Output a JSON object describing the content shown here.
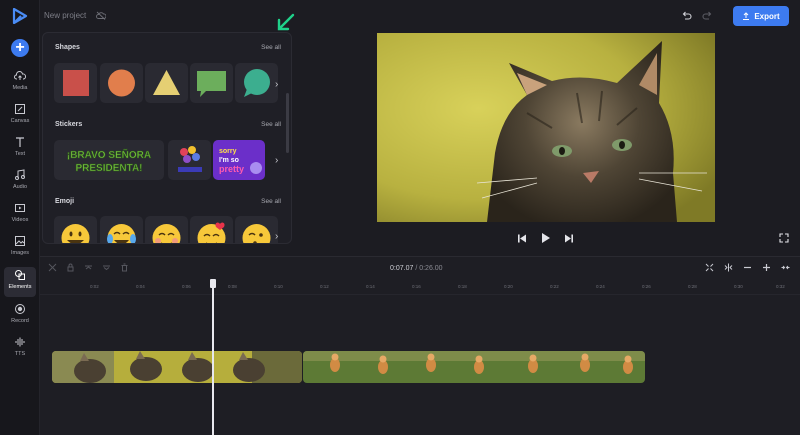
{
  "app": {
    "project_name": "New project",
    "export_label": "Export",
    "accent": "#3d7bf0"
  },
  "sidebar": {
    "add_label": "+",
    "items": [
      {
        "label": "Media",
        "icon": "cloud-upload-icon"
      },
      {
        "label": "Canvas",
        "icon": "canvas-icon"
      },
      {
        "label": "Text",
        "icon": "text-icon"
      },
      {
        "label": "Audio",
        "icon": "music-icon"
      },
      {
        "label": "Videos",
        "icon": "video-icon"
      },
      {
        "label": "Images",
        "icon": "image-icon"
      },
      {
        "label": "Elements",
        "icon": "elements-icon",
        "active": true
      },
      {
        "label": "Record",
        "icon": "record-icon"
      },
      {
        "label": "TTS",
        "icon": "tts-icon"
      }
    ]
  },
  "panel": {
    "shapes": {
      "title": "Shapes",
      "see_all": "See all",
      "items": [
        {
          "shape": "square",
          "color": "#c9504a"
        },
        {
          "shape": "circle",
          "color": "#e17e4c"
        },
        {
          "shape": "triangle",
          "color": "#e5cf73"
        },
        {
          "shape": "speech-bubble-rect",
          "color": "#6cae5c"
        },
        {
          "shape": "speech-bubble-round",
          "color": "#3cae8f"
        }
      ]
    },
    "stickers": {
      "title": "Stickers",
      "see_all": "See all",
      "items": [
        {
          "text": "¡BRAVO SEÑORA PRESIDENTA!"
        },
        {
          "text": "balloons"
        },
        {
          "text": "sorry I'm so pretty"
        }
      ]
    },
    "emoji": {
      "title": "Emoji",
      "see_all": "See all",
      "items": [
        "grinning",
        "tears-of-joy",
        "smiling-eyes",
        "heart-face",
        "kissing"
      ]
    }
  },
  "player": {
    "prev_icon": "skip-back-icon",
    "play_icon": "play-icon",
    "next_icon": "skip-forward-icon",
    "fullscreen_icon": "fullscreen-icon"
  },
  "timeline": {
    "current_time": "0:07.07",
    "separator": "/",
    "total_time": "0:26.00",
    "ticks": [
      "0:02",
      "0:04",
      "0:06",
      "0:08",
      "0:10",
      "0:12",
      "0:14",
      "0:16",
      "0:18",
      "0:20",
      "0:22",
      "0:24",
      "0:26",
      "0:28",
      "0:30",
      "0:32"
    ],
    "tick_zero": ""
  }
}
